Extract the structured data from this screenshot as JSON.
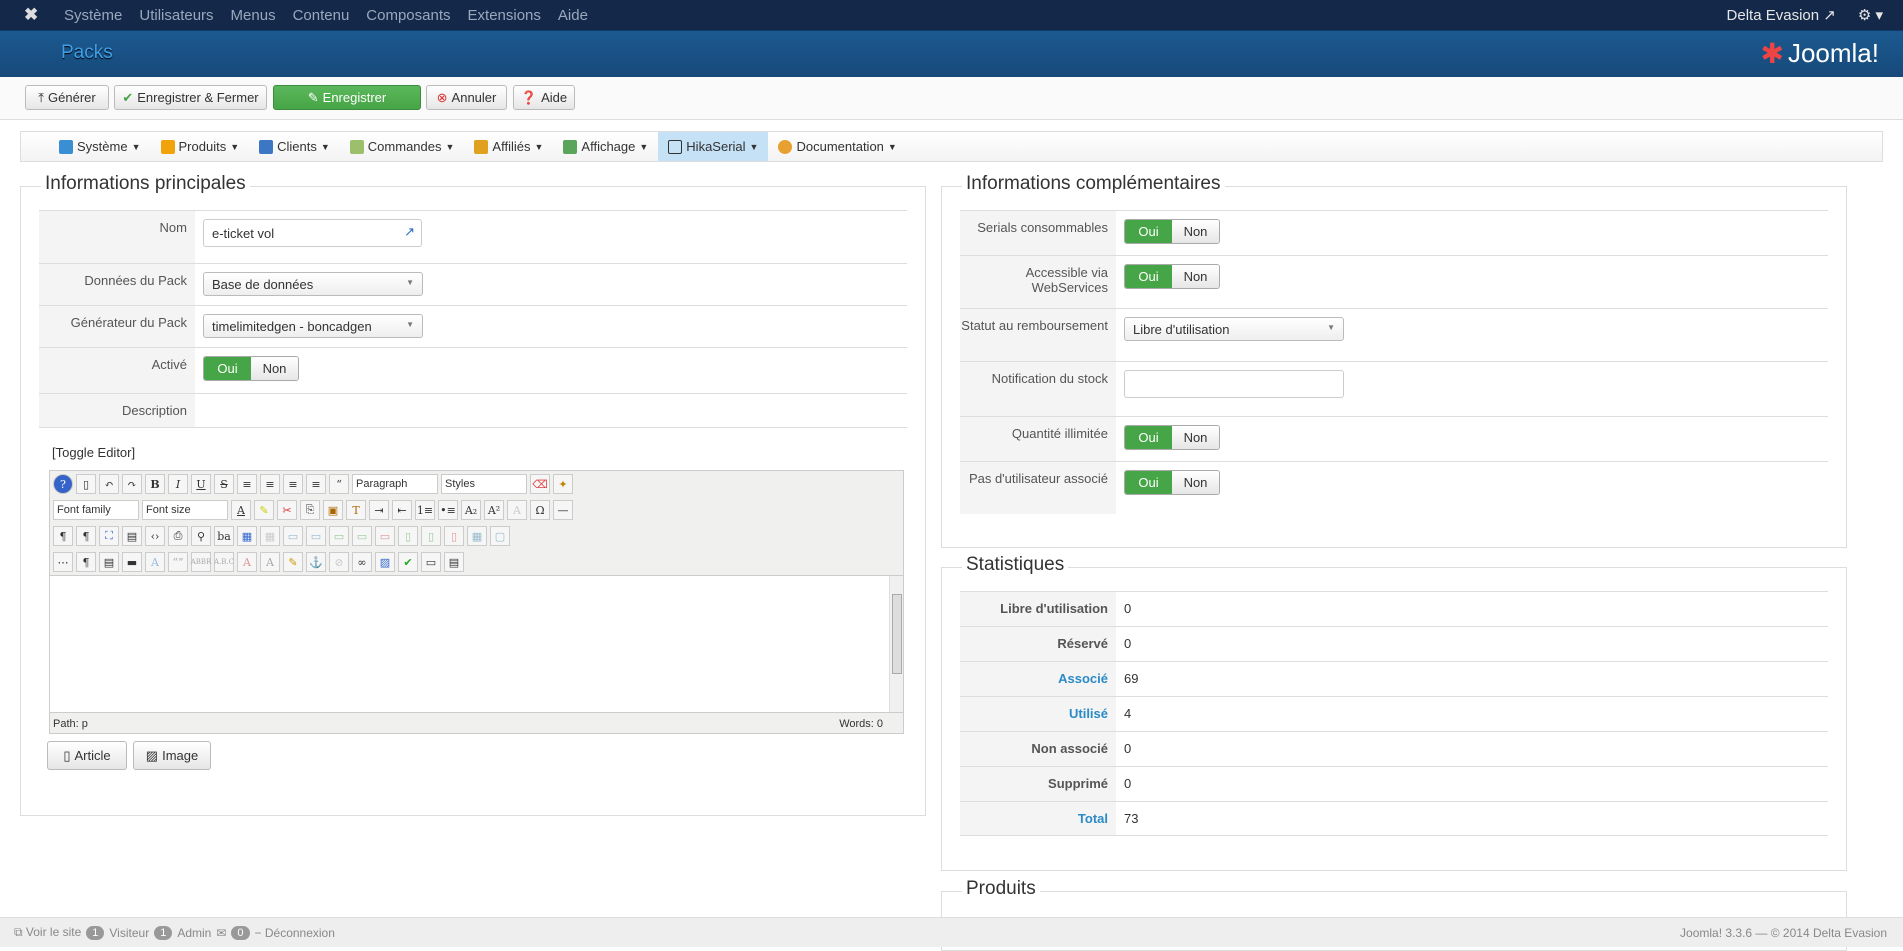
{
  "topnav": {
    "menu": [
      "Système",
      "Utilisateurs",
      "Menus",
      "Contenu",
      "Composants",
      "Extensions",
      "Aide"
    ],
    "site": "Delta Evasion"
  },
  "header": {
    "title": "Packs",
    "logo": "Joomla!"
  },
  "toolbar": {
    "generate": "Générer",
    "save_close": "Enregistrer & Fermer",
    "save": "Enregistrer",
    "cancel": "Annuler",
    "help": "Aide"
  },
  "submenu": [
    {
      "label": "Système",
      "color": "#3a8fd4"
    },
    {
      "label": "Produits",
      "color": "#f0a30a"
    },
    {
      "label": "Clients",
      "color": "#3b77c2"
    },
    {
      "label": "Commandes",
      "color": "#9bbf6b"
    },
    {
      "label": "Affiliés",
      "color": "#e0a020"
    },
    {
      "label": "Affichage",
      "color": "#5aa55a"
    },
    {
      "label": "HikaSerial",
      "color": "#333333"
    },
    {
      "label": "Documentation",
      "color": "#e8a030"
    }
  ],
  "main": {
    "legend": "Informations principales",
    "name_label": "Nom",
    "name_value": "e-ticket vol",
    "data_label": "Données du Pack",
    "data_value": "Base de données",
    "gen_label": "Générateur du Pack",
    "gen_value": "timelimitedgen - boncadgen",
    "active_label": "Activé",
    "desc_label": "Description",
    "toggle_editor": "[Toggle Editor]",
    "paragraph": "Paragraph",
    "styles": "Styles",
    "font_family": "Font family",
    "font_size": "Font size",
    "path": "Path:  p",
    "words": "Words: 0",
    "article": "Article",
    "image": "Image"
  },
  "toggle": {
    "yes": "Oui",
    "no": "Non"
  },
  "extra": {
    "legend": "Informations complémentaires",
    "consumable": "Serials consommables",
    "webservices": "Accessible via WebServices",
    "refund_label": "Statut au remboursement",
    "refund_value": "Libre d'utilisation",
    "stock_label": "Notification du stock",
    "unlimited": "Quantité illimitée",
    "no_user": "Pas d'utilisateur associé"
  },
  "stats": {
    "legend": "Statistiques",
    "rows": [
      {
        "label": "Libre d'utilisation",
        "value": "0"
      },
      {
        "label": "Réservé",
        "value": "0"
      },
      {
        "label": "Associé",
        "value": "69"
      },
      {
        "label": "Utilisé",
        "value": "4"
      },
      {
        "label": "Non associé",
        "value": "0"
      },
      {
        "label": "Supprimé",
        "value": "0"
      },
      {
        "label": "Total",
        "value": "73"
      }
    ]
  },
  "products": {
    "legend": "Produits"
  },
  "footer": {
    "view_site": "Voir le site",
    "visitors_count": "1",
    "visitors": "Visiteur",
    "admin_count": "1",
    "admin": "Admin",
    "msg_count": "0",
    "logout": "Déconnexion",
    "version": "Joomla! 3.3.6  —  © 2014 Delta Evasion"
  }
}
